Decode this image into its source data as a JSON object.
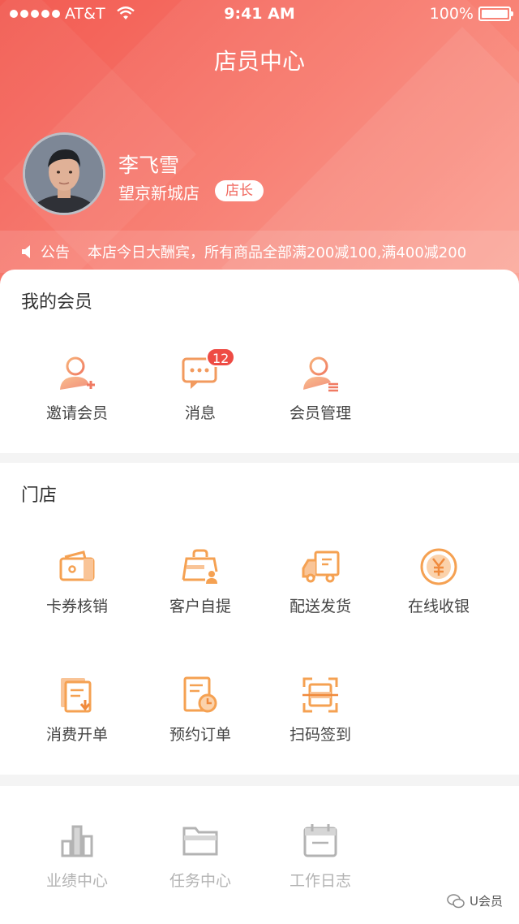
{
  "status_bar": {
    "carrier": "AT&T",
    "time": "9:41 AM",
    "battery": "100%"
  },
  "header": {
    "title": "店员中心"
  },
  "profile": {
    "name": "李飞雪",
    "store": "望京新城店",
    "role": "店长"
  },
  "notice": {
    "label": "公告",
    "text": "本店今日大酬宾，所有商品全部满200减100,满400减200"
  },
  "members": {
    "title": "我的会员",
    "items": [
      {
        "label": "邀请会员",
        "icon": "invite-member-icon"
      },
      {
        "label": "消息",
        "icon": "message-icon",
        "badge": "12"
      },
      {
        "label": "会员管理",
        "icon": "member-manage-icon"
      }
    ]
  },
  "store": {
    "title": "门店",
    "items": [
      {
        "label": "卡券核销",
        "icon": "coupon-verify-icon"
      },
      {
        "label": "客户自提",
        "icon": "customer-pickup-icon"
      },
      {
        "label": "配送发货",
        "icon": "delivery-truck-icon"
      },
      {
        "label": "在线收银",
        "icon": "yen-coin-icon"
      },
      {
        "label": "消费开单",
        "icon": "billing-doc-icon"
      },
      {
        "label": "预约订单",
        "icon": "appointment-order-icon"
      },
      {
        "label": "扫码签到",
        "icon": "scan-qr-icon"
      }
    ]
  },
  "bottom": {
    "items": [
      {
        "label": "业绩中心",
        "icon": "bar-chart-icon"
      },
      {
        "label": "任务中心",
        "icon": "folder-icon"
      },
      {
        "label": "工作日志",
        "icon": "calendar-icon"
      }
    ]
  },
  "watermark": {
    "text": "U会员"
  },
  "colors": {
    "accent": "#f25b52",
    "icon_orange": "#f5a152",
    "icon_gray": "#b3b3b3",
    "badge_red": "#ee4b44"
  }
}
